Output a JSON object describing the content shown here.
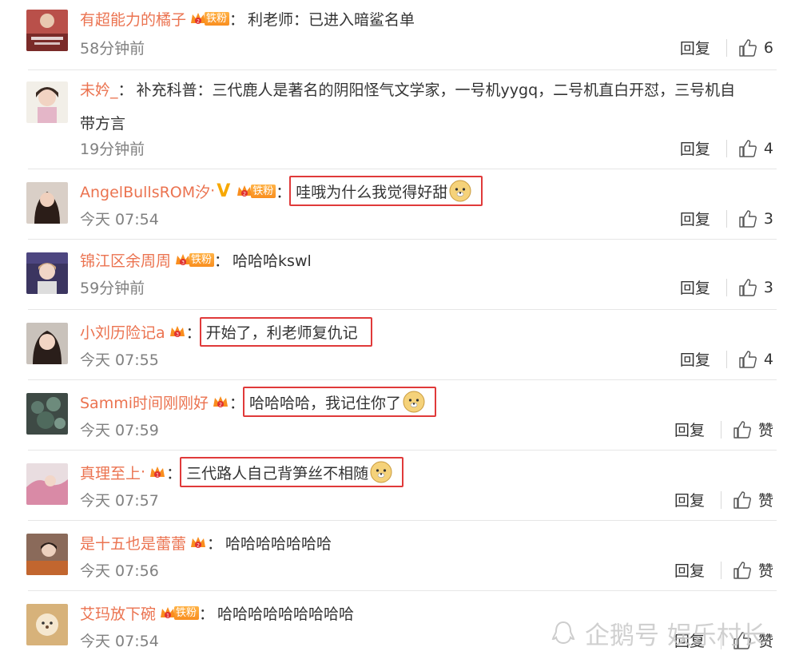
{
  "comments": [
    {
      "user": "有超能力的橘子",
      "fan_label": "铁粉",
      "text": "利老师：已进入暗鲨名单",
      "time": "58分钟前",
      "reply": "回复",
      "likes": "6"
    },
    {
      "user": "未妗_",
      "text": "补充科普：三代鹿人是著名的阴阳怪气文学家，一号机yygq，二号机直白开怼，三号机自",
      "text2": "带方言",
      "time": "19分钟前",
      "reply": "回复",
      "likes": "4"
    },
    {
      "user": "AngelBullsROM汐",
      "verified": "V",
      "fan_label": "铁粉",
      "text": "哇哦为什么我觉得好甜",
      "time": "今天 07:54",
      "reply": "回复",
      "likes": "3"
    },
    {
      "user": "锦江区余周周",
      "fan_label": "铁粉",
      "text": "哈哈哈kswl",
      "time": "59分钟前",
      "reply": "回复",
      "likes": "3"
    },
    {
      "user": "小刘历险记a",
      "text": "开始了，利老师复仇记",
      "time": "今天 07:55",
      "reply": "回复",
      "likes": "4"
    },
    {
      "user": "Sammi时间刚刚好",
      "text": "哈哈哈哈，我记住你了",
      "time": "今天 07:59",
      "reply": "回复",
      "likes": "赞"
    },
    {
      "user": "真理至上",
      "text": "三代路人自己背笋丝不相随",
      "time": "今天 07:57",
      "reply": "回复",
      "likes": "赞"
    },
    {
      "user": "是十五也是蕾蕾",
      "text": "哈哈哈哈哈哈哈",
      "time": "今天 07:56",
      "reply": "回复",
      "likes": "赞"
    },
    {
      "user": "艾玛放下碗",
      "fan_label": "铁粉",
      "text": "哈哈哈哈哈哈哈哈哈",
      "time": "今天 07:54",
      "reply": "回复",
      "likes": "赞"
    }
  ],
  "watermark": "企鹅号 娱乐村长",
  "colors": {
    "username": "#eb7350",
    "highlight_border": "#e03a3a",
    "time": "#808080",
    "fan_badge": "#f98e1f"
  }
}
